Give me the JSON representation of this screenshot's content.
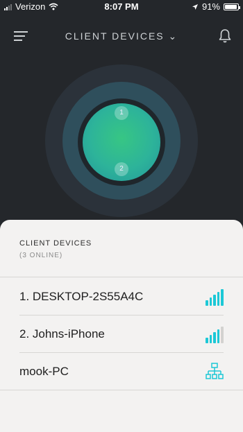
{
  "status_bar": {
    "carrier": "Verizon",
    "time": "8:07 PM",
    "battery": "91%"
  },
  "header": {
    "title": "CLIENT DEVICES ⌄"
  },
  "radar": {
    "markers": [
      "1",
      "2"
    ]
  },
  "sheet": {
    "title": "CLIENT DEVICES",
    "subtitle": "(3 ONLINE)",
    "devices": [
      {
        "label": "1.  DESKTOP-2S55A4C",
        "connection": "wifi",
        "signal_bars": 5
      },
      {
        "label": "2.  Johns-iPhone",
        "connection": "wifi",
        "signal_bars": 4
      },
      {
        "label": "mook-PC",
        "connection": "ethernet"
      }
    ]
  },
  "colors": {
    "accent": "#1cc8d6",
    "dark_bg": "#24272b",
    "sheet_bg": "#f3f2f1"
  },
  "icons": [
    "signal-icon",
    "wifi-icon",
    "location-icon",
    "battery-icon",
    "menu-icon",
    "bell-icon",
    "wifi-signal-icon",
    "network-icon"
  ]
}
